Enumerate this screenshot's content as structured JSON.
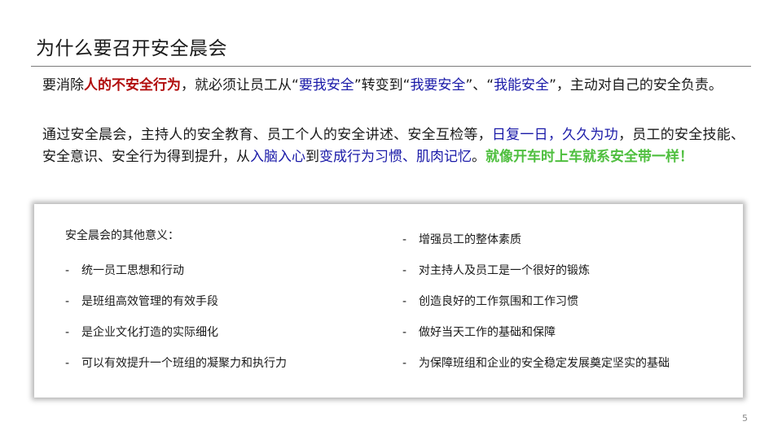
{
  "slide": {
    "title": "为什么要召开安全晨会",
    "page_number": "5"
  },
  "paragraph1": {
    "s1": "要消除",
    "s2": "人的不安全行为",
    "s3": "，就必须让员工从“",
    "s4": "要我安全",
    "s5": "”转变到“",
    "s6": "我要安全",
    "s7": "”、“",
    "s8": "我能安全",
    "s9": "”，主动对自己的安全负责。"
  },
  "paragraph2": {
    "s1": "通过安全晨会，主持人的安全教育、员工个人的安全讲述、安全互检等，",
    "s2": "日复一日，久久为功",
    "s3": "，员工的安全技能、安全意识、安全行为得到提升，从",
    "s4": "入脑入心",
    "s5": "到",
    "s6": "变成行为习惯、肌肉记忆",
    "s7": "。",
    "s8": "就像开车时上车就系安全带一样！"
  },
  "panel": {
    "intro": "安全晨会的其他意义：",
    "bullet": "-",
    "left_items": [
      "统一员工思想和行动",
      "是班组高效管理的有效手段",
      "是企业文化打造的实际细化",
      "可以有效提升一个班组的凝聚力和执行力"
    ],
    "right_items": [
      "增强员工的整体素质",
      "对主持人及员工是一个很好的锻炼",
      "创造良好的工作氛围和工作习惯",
      "做好当天工作的基础和保障",
      "为保障班组和企业的安全稳定发展奠定坚实的基础"
    ]
  },
  "colors": {
    "emphasis_red": "#b10d0d",
    "emphasis_blue": "#1a1aa8",
    "emphasis_green": "#4fbf3f"
  }
}
